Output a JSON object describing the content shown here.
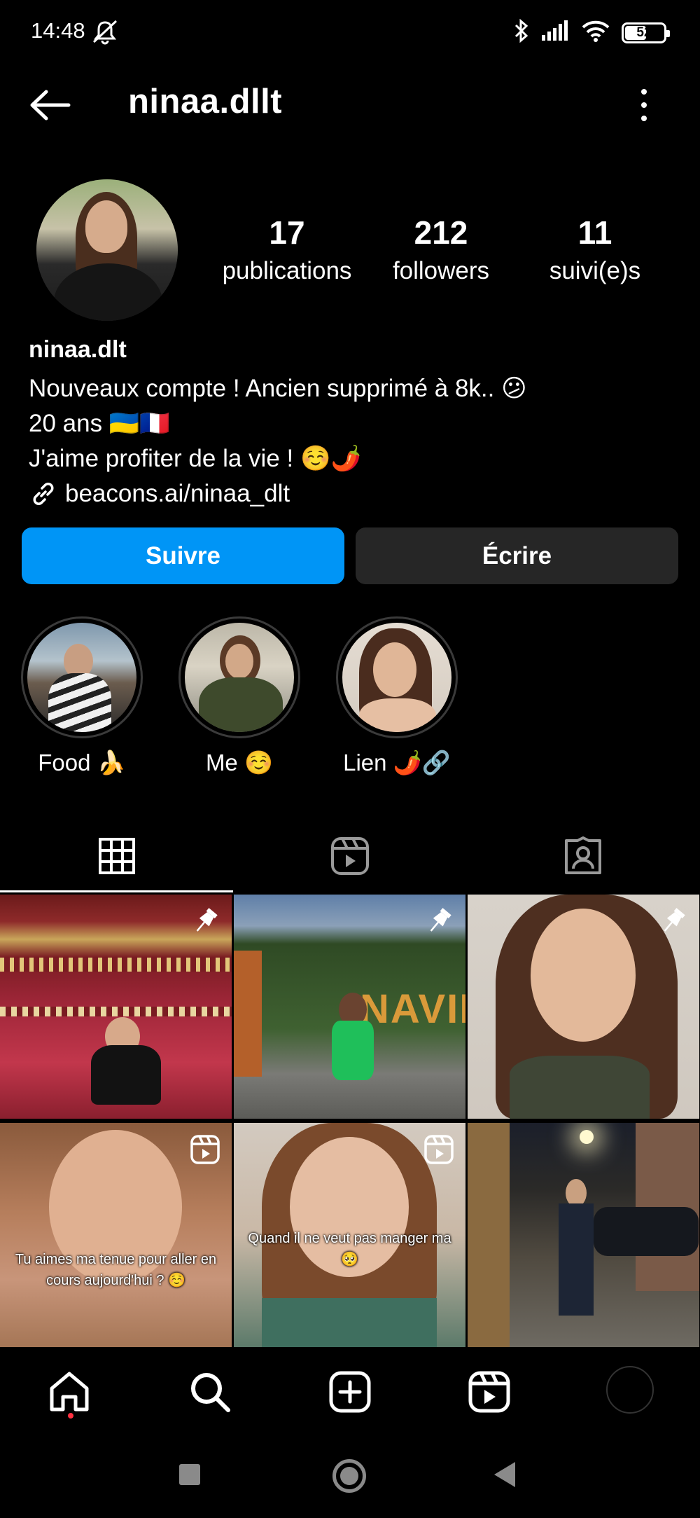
{
  "status_bar": {
    "time": "14:48",
    "battery": "52",
    "battery_level": 0.52
  },
  "header": {
    "title": "ninaa.dllt"
  },
  "profile": {
    "stats": [
      {
        "value": "17",
        "label": "publications"
      },
      {
        "value": "212",
        "label": "followers"
      },
      {
        "value": "11",
        "label": "suivi(e)s"
      }
    ],
    "bio": {
      "name": "ninaa.dlt",
      "line1": "Nouveaux compte ! Ancien supprimé à 8k.. 😕",
      "line2": "20 ans 🇺🇦🇫🇷",
      "line3": "J'aime profiter de la vie ! ☺️🌶️",
      "link": "beacons.ai/ninaa_dlt"
    }
  },
  "actions": {
    "follow_label": "Suivre",
    "message_label": "Écrire"
  },
  "highlights": [
    {
      "label": "Food 🍌"
    },
    {
      "label": "Me ☺️"
    },
    {
      "label": "Lien 🌶️🔗"
    }
  ],
  "posts": [
    {
      "type": "pinned"
    },
    {
      "type": "pinned",
      "sign_text": "NAVID"
    },
    {
      "type": "pinned"
    },
    {
      "type": "reel",
      "caption": "Tu aimes ma tenue pour aller en cours aujourd'hui ? ☺️"
    },
    {
      "type": "reel",
      "caption": "Quand il ne veut pas manger ma 🥺"
    },
    {
      "type": "photo"
    }
  ]
}
